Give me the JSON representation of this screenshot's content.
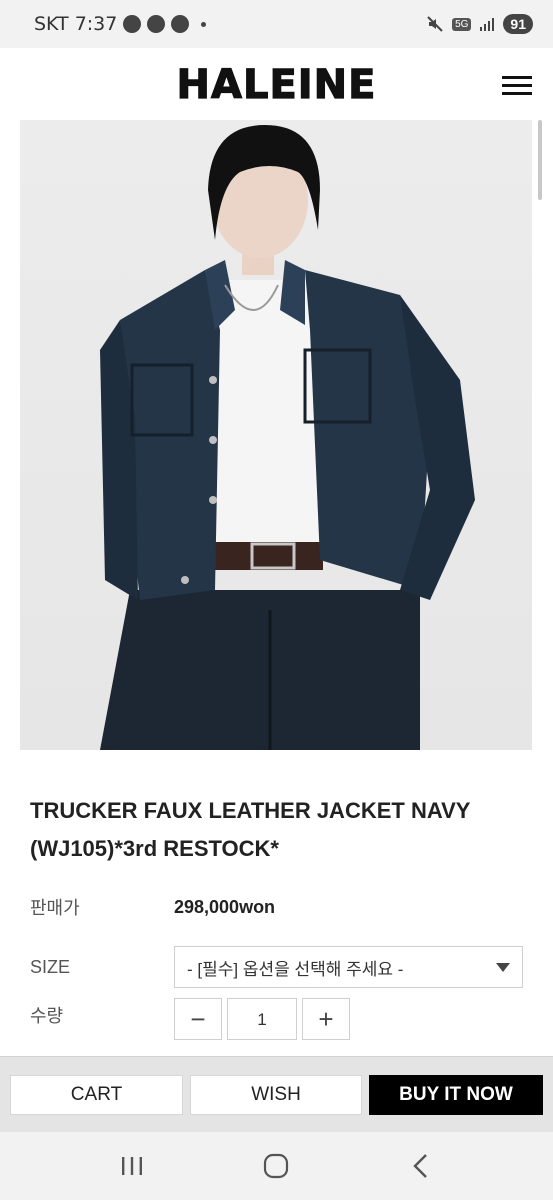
{
  "status_bar": {
    "carrier_time": "SKT 7:37",
    "network": "5G",
    "battery": "91"
  },
  "header": {
    "logo": "HALEINE",
    "menu_icon": "hamburger-menu-icon"
  },
  "product": {
    "title": "TRUCKER FAUX LEATHER JACKET NAVY (WJ105)*3rd RESTOCK*",
    "price_label": "판매가",
    "price": "298,000won",
    "size_label": "SIZE",
    "size_placeholder": "- [필수] 옵션을 선택해 주세요 -",
    "qty_label": "수량",
    "qty_value": "1",
    "qty_minus": "−",
    "qty_plus": "+"
  },
  "actions": {
    "cart": "CART",
    "wish": "WISH",
    "buy": "BUY IT NOW"
  },
  "colors": {
    "buy_bg": "#000000",
    "jacket": "#1f2d3d"
  }
}
